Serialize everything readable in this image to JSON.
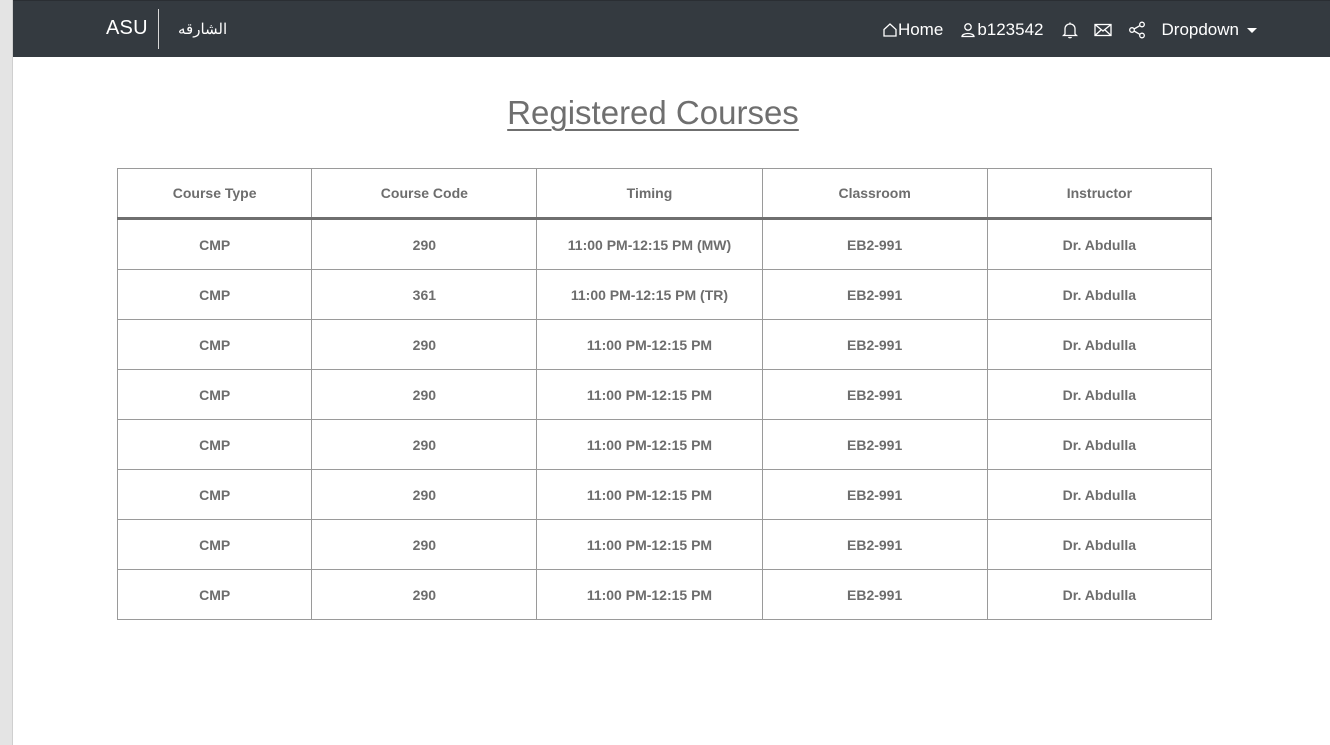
{
  "navbar": {
    "brand": "ASU",
    "brand_arabic": "الشارقه",
    "home_label": "Home",
    "username": "b123542",
    "dropdown_label": "Dropdown"
  },
  "icons": {
    "home": "home-icon",
    "user": "user-icon",
    "notifications": "bell-icon",
    "messages": "envelope-icon",
    "share": "share-icon",
    "dropdown": "caret-down-icon"
  },
  "colors": {
    "navbar_bg": "#343a40",
    "text_gray": "#6d6d6d"
  },
  "page": {
    "title": "Registered Courses"
  },
  "table": {
    "headers": [
      "Course Type",
      "Course Code",
      "Timing",
      "Classroom",
      "Instructor"
    ],
    "rows": [
      [
        "CMP",
        "290",
        "11:00 PM-12:15 PM (MW)",
        "EB2-991",
        "Dr. Abdulla"
      ],
      [
        "CMP",
        "361",
        "11:00 PM-12:15 PM (TR)",
        "EB2-991",
        "Dr. Abdulla"
      ],
      [
        "CMP",
        "290",
        "11:00 PM-12:15 PM",
        "EB2-991",
        "Dr. Abdulla"
      ],
      [
        "CMP",
        "290",
        "11:00 PM-12:15 PM",
        "EB2-991",
        "Dr. Abdulla"
      ],
      [
        "CMP",
        "290",
        "11:00 PM-12:15 PM",
        "EB2-991",
        "Dr. Abdulla"
      ],
      [
        "CMP",
        "290",
        "11:00 PM-12:15 PM",
        "EB2-991",
        "Dr. Abdulla"
      ],
      [
        "CMP",
        "290",
        "11:00 PM-12:15 PM",
        "EB2-991",
        "Dr. Abdulla"
      ],
      [
        "CMP",
        "290",
        "11:00 PM-12:15 PM",
        "EB2-991",
        "Dr. Abdulla"
      ]
    ]
  }
}
